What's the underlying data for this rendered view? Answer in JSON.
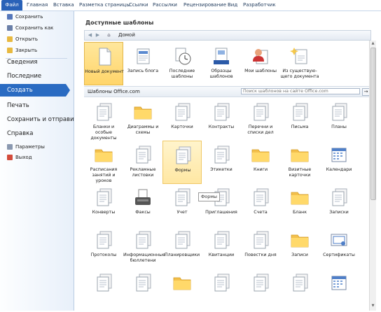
{
  "tabs": [
    "Файл",
    "Главная",
    "Вставка",
    "Разметка страницы",
    "Ссылки",
    "Рассылки",
    "Рецензирование",
    "Вид",
    "Разработчик"
  ],
  "sidebar": {
    "save": "Сохранить",
    "save_as": "Сохранить как",
    "open": "Открыть",
    "close": "Закрыть",
    "info": "Сведения",
    "recent": "Последние",
    "create": "Создать",
    "print": "Печать",
    "save_send": "Сохранить и отправить",
    "help": "Справка",
    "options": "Параметры",
    "exit": "Выход"
  },
  "main": {
    "title": "Доступные шаблоны",
    "crumb": "Домой",
    "office_heading": "Шаблоны Office.com",
    "search_placeholder": "Поиск шаблонов на сайте Office.com",
    "tooltip": "Формы"
  },
  "top_templates": [
    {
      "label": "Новый документ",
      "icon": "blank-document-icon"
    },
    {
      "label": "Запись блога",
      "icon": "blog-post-icon"
    },
    {
      "label": "Последние шаблоны",
      "icon": "recent-templates-icon"
    },
    {
      "label": "Образцы шаблонов",
      "icon": "sample-templates-icon"
    },
    {
      "label": "Мои шаблоны",
      "icon": "my-templates-icon"
    },
    {
      "label": "Из существую-щего документа",
      "icon": "from-existing-icon"
    }
  ],
  "office_templates": [
    {
      "label": "Бланки и особые документы",
      "icon": "doc-icon"
    },
    {
      "label": "Диаграммы и схемы",
      "icon": "folder-icon"
    },
    {
      "label": "Карточки",
      "icon": "doc-icon"
    },
    {
      "label": "Контракты",
      "icon": "doc-icon"
    },
    {
      "label": "Перечни и списки дел",
      "icon": "doc-icon"
    },
    {
      "label": "Письма",
      "icon": "doc-icon"
    },
    {
      "label": "Планы",
      "icon": "doc-icon"
    },
    {
      "label": "Расписания занятий и уроков",
      "icon": "folder-icon"
    },
    {
      "label": "Рекламные листовки",
      "icon": "doc-icon"
    },
    {
      "label": "Формы",
      "icon": "doc-icon"
    },
    {
      "label": "Этикетки",
      "icon": "doc-icon"
    },
    {
      "label": "Книги",
      "icon": "folder-icon"
    },
    {
      "label": "Визитные карточки",
      "icon": "folder-icon"
    },
    {
      "label": "Календари",
      "icon": "calendar-icon"
    },
    {
      "label": "Конверты",
      "icon": "doc-icon"
    },
    {
      "label": "Факсы",
      "icon": "fax-icon"
    },
    {
      "label": "Учет",
      "icon": "doc-icon"
    },
    {
      "label": "Приглашения",
      "icon": "doc-icon"
    },
    {
      "label": "Счета",
      "icon": "doc-icon"
    },
    {
      "label": "Бланк",
      "icon": "folder-icon"
    },
    {
      "label": "Записки",
      "icon": "doc-icon"
    },
    {
      "label": "Протоколы",
      "icon": "doc-icon"
    },
    {
      "label": "Информационные бюллетени",
      "icon": "doc-icon"
    },
    {
      "label": "Планировщики",
      "icon": "doc-icon"
    },
    {
      "label": "Квитанции",
      "icon": "doc-icon"
    },
    {
      "label": "Повестки дня",
      "icon": "doc-icon"
    },
    {
      "label": "Записи",
      "icon": "folder-icon"
    },
    {
      "label": "Сертификаты",
      "icon": "certificate-icon"
    },
    {
      "label": "",
      "icon": "doc-icon"
    },
    {
      "label": "",
      "icon": "doc-icon"
    },
    {
      "label": "",
      "icon": "folder-icon"
    },
    {
      "label": "",
      "icon": "doc-icon"
    },
    {
      "label": "",
      "icon": "doc-icon"
    },
    {
      "label": "",
      "icon": "doc-icon"
    },
    {
      "label": "",
      "icon": "calendar-icon"
    }
  ],
  "colors": {
    "accent": "#2a6bc2",
    "folder": "#f3c04c",
    "selected": "#ffd56a"
  }
}
